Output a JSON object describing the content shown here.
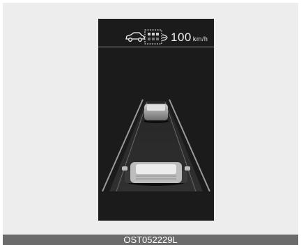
{
  "display": {
    "speed_value": "100",
    "speed_unit": "km/h",
    "icons": [
      "own-car-icon",
      "distance-gap-bars-icon",
      "lead-car-icon"
    ],
    "colors": {
      "background": "#1b1b1b",
      "text": "#f2f2f2",
      "road_edge": "#9a9a9a"
    }
  },
  "figure": {
    "caption": "OST052229L"
  }
}
